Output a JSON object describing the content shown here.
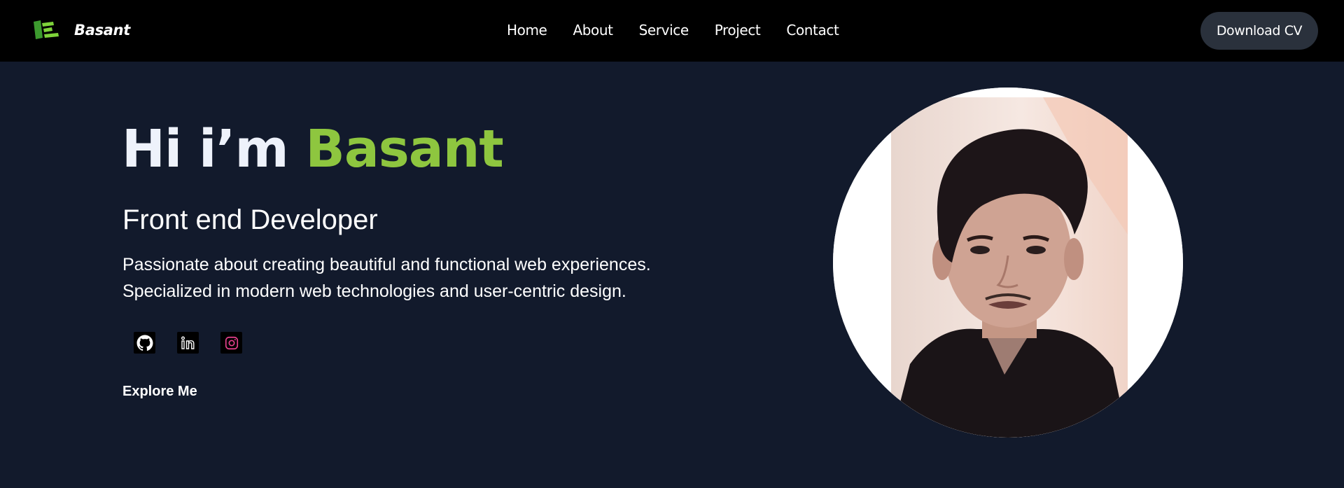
{
  "brand": {
    "name": "Basant",
    "icon": "logo-e-icon",
    "accent": "#8ec63f"
  },
  "nav": {
    "links": [
      "Home",
      "About",
      "Service",
      "Project",
      "Contact"
    ],
    "cta_label": "Download CV"
  },
  "hero": {
    "greeting": "Hi i’m",
    "name": "Basant",
    "role": "Front end Developer",
    "bio_line_1": "Passionate about creating beautiful and functional web experiences.",
    "bio_line_2": "Specialized in modern web technologies and user-centric design.",
    "explore_label": "Explore Me"
  },
  "socials": [
    {
      "icon": "github-icon"
    },
    {
      "icon": "linkedin-icon"
    },
    {
      "icon": "instagram-icon"
    }
  ],
  "colors": {
    "background": "#121a2c",
    "navbar": "#000000",
    "button": "#2a313c",
    "accent": "#8ec63f"
  }
}
